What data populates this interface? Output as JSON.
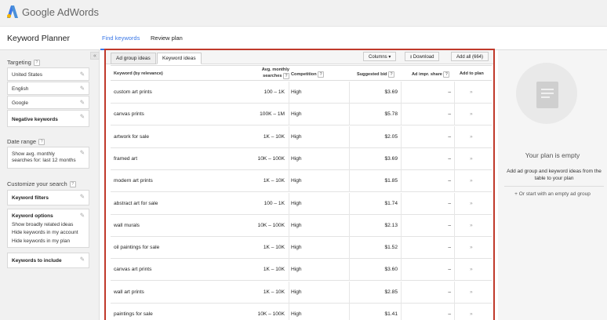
{
  "app": {
    "logo_text": "Google AdWords"
  },
  "header": {
    "title": "Keyword Planner",
    "tabs": [
      {
        "label": "Find keywords"
      },
      {
        "label": "Review plan"
      }
    ]
  },
  "sidebar": {
    "collapse_glyph": "«",
    "targeting_label": "Targeting",
    "targeting_items": [
      "United States",
      "English",
      "Google",
      "Negative keywords"
    ],
    "date_range_label": "Date range",
    "date_range_value": "Show avg. monthly searches for: last 12 months",
    "customize_label": "Customize your search",
    "keyword_filters": "Keyword filters",
    "keyword_options": {
      "title": "Keyword options",
      "lines": [
        "Show broadly related ideas",
        "Hide keywords in my account",
        "Hide keywords in my plan"
      ]
    },
    "keywords_include": "Keywords to include"
  },
  "main": {
    "subtabs": [
      "Ad group ideas",
      "Keyword ideas"
    ],
    "buttons": {
      "columns": "Columns ▾",
      "download": "Download",
      "add_all": "Add all (664)"
    },
    "columns": {
      "keyword": "Keyword (by relevance)",
      "searches_1": "Avg. monthly",
      "searches_2": "searches",
      "competition": "Competition",
      "bid": "Suggested bid",
      "impr": "Ad impr. share",
      "add": "Add to plan"
    },
    "rows": [
      {
        "keyword": "custom art prints",
        "searches": "100 – 1K",
        "competition": "High",
        "bid": "$3.69",
        "impr": "–"
      },
      {
        "keyword": "canvas prints",
        "searches": "100K – 1M",
        "competition": "High",
        "bid": "$5.78",
        "impr": "–"
      },
      {
        "keyword": "artwork for sale",
        "searches": "1K – 10K",
        "competition": "High",
        "bid": "$2.05",
        "impr": "–"
      },
      {
        "keyword": "framed art",
        "searches": "10K – 100K",
        "competition": "High",
        "bid": "$3.69",
        "impr": "–"
      },
      {
        "keyword": "modern art prints",
        "searches": "1K – 10K",
        "competition": "High",
        "bid": "$1.85",
        "impr": "–"
      },
      {
        "keyword": "abstract art for sale",
        "searches": "100 – 1K",
        "competition": "High",
        "bid": "$1.74",
        "impr": "–"
      },
      {
        "keyword": "wall murals",
        "searches": "10K – 100K",
        "competition": "High",
        "bid": "$2.13",
        "impr": "–"
      },
      {
        "keyword": "oil paintings for sale",
        "searches": "1K – 10K",
        "competition": "High",
        "bid": "$1.52",
        "impr": "–"
      },
      {
        "keyword": "canvas art prints",
        "searches": "1K – 10K",
        "competition": "High",
        "bid": "$3.60",
        "impr": "–"
      },
      {
        "keyword": "wall art prints",
        "searches": "1K – 10K",
        "competition": "High",
        "bid": "$2.85",
        "impr": "–"
      },
      {
        "keyword": "paintings for sale",
        "searches": "10K – 100K",
        "competition": "High",
        "bid": "$1.41",
        "impr": "–"
      }
    ],
    "add_glyph": "»"
  },
  "plan": {
    "empty_title": "Your plan is empty",
    "desc": "Add ad group and keyword ideas from the table to your plan",
    "link": "+ Or start with an empty ad group"
  },
  "colors": {
    "accent": "#3b78e7",
    "highlight_border": "#c0392b"
  }
}
